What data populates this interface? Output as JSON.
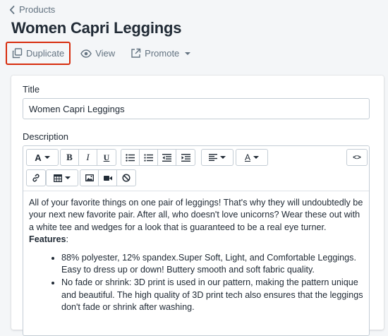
{
  "breadcrumb": {
    "label": "Products"
  },
  "page": {
    "title": "Women Capri Leggings"
  },
  "actions": {
    "duplicate": "Duplicate",
    "view": "View",
    "promote": "Promote"
  },
  "form": {
    "title_label": "Title",
    "title_value": "Women Capri Leggings",
    "description_label": "Description"
  },
  "toolbar": {
    "font_letter": "A",
    "bold": "B",
    "italic": "I",
    "underline": "U",
    "color_letter": "A",
    "html": "<>"
  },
  "description": {
    "intro": "All of your favorite things on one pair of leggings!  That's why they will undoubtedly be your next new favorite pair. After all, who doesn't love unicorns?   Wear these out with a white tee and wedges for a look that is guaranteed to be a real eye turner.",
    "features_label": "Features",
    "features_suffix": ":",
    "bullets": [
      "88% polyester, 12% spandex.Super Soft, Light, and Comfortable Leggings. Easy to dress up or down! Buttery smooth and soft fabric quality.",
      "No fade or shrink: 3D print is used in our pattern, making the pattern unique and beautiful. The high quality of 3D print tech also ensures that the leggings don't fade or shrink after washing."
    ]
  },
  "colors": {
    "highlight_border": "#d72c0d",
    "muted_text": "#637381",
    "page_bg": "#f4f6f8"
  }
}
